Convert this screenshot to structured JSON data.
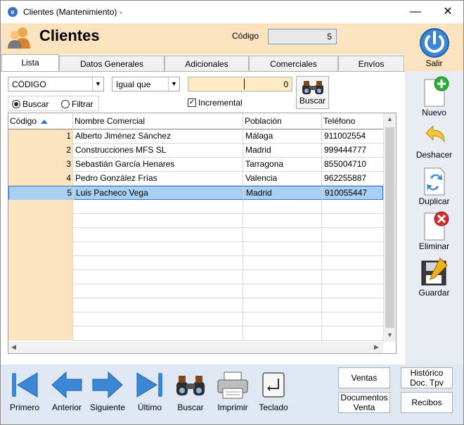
{
  "window": {
    "title": "Clientes (Mantenimiento) -",
    "minimize": "—",
    "close": "✕"
  },
  "header": {
    "title": "Clientes",
    "codigo_label": "Código",
    "codigo_value": "5"
  },
  "tabs": [
    {
      "label": "Lista"
    },
    {
      "label": "Datos Generales"
    },
    {
      "label": "Adicionales"
    },
    {
      "label": "Comerciales"
    },
    {
      "label": "Envíos"
    }
  ],
  "filters": {
    "field_select": "CÓDIGO",
    "operator_select": "Igual que",
    "value": "0",
    "buscar_button": "Buscar",
    "radio_buscar": "Buscar",
    "radio_filtrar": "Filtrar",
    "incremental": "Incremental"
  },
  "grid": {
    "columns": [
      "Código",
      "Nombre Comercial",
      "Población",
      "Teléfono"
    ],
    "rows": [
      {
        "codigo": "1",
        "nombre": "Alberto Jiménez Sánchez",
        "poblacion": "Málaga",
        "telefono": "911002554"
      },
      {
        "codigo": "2",
        "nombre": "Construcciones MFS SL",
        "poblacion": "Madrid",
        "telefono": "999444777"
      },
      {
        "codigo": "3",
        "nombre": "Sebastián García Henares",
        "poblacion": "Tarragona",
        "telefono": "855004710"
      },
      {
        "codigo": "4",
        "nombre": "Pedro González Frías",
        "poblacion": "Valencia",
        "telefono": "962255887"
      },
      {
        "codigo": "5",
        "nombre": "Luis Pacheco Vega",
        "poblacion": "Madrid",
        "telefono": "910055447"
      }
    ]
  },
  "right_panel": {
    "salir": "Salir",
    "nuevo": "Nuevo",
    "deshacer": "Deshacer",
    "duplicar": "Duplicar",
    "eliminar": "Eliminar",
    "guardar": "Guardar"
  },
  "bottom_nav": {
    "primero": "Primero",
    "anterior": "Anterior",
    "siguiente": "Siguiente",
    "ultimo": "Último",
    "buscar": "Buscar",
    "imprimir": "Imprimir",
    "teclado": "Teclado"
  },
  "bottom_buttons": {
    "ventas": "Ventas",
    "documentos_l1": "Documentos",
    "documentos_l2": "Venta",
    "historico_l1": "Histórico",
    "historico_l2": "Doc. Tpv",
    "recibos": "Recibos"
  },
  "colors": {
    "accent": "#3a74c4",
    "header_bg": "#fbe3c0",
    "selection": "#a9d0f2"
  }
}
